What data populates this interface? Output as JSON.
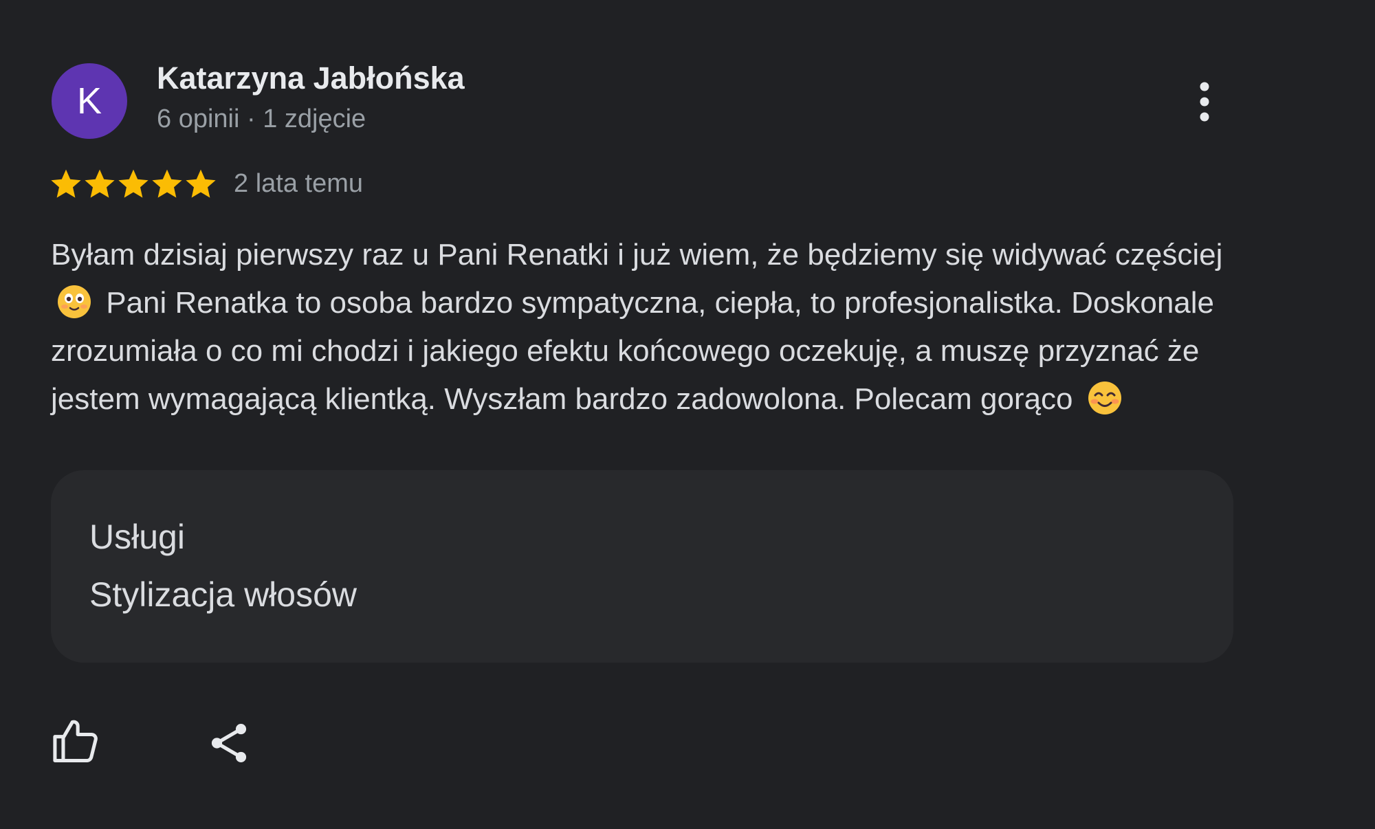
{
  "author": {
    "avatar_initial": "K",
    "avatar_color": "#5e35b1",
    "name": "Katarzyna Jabłońska",
    "meta": "6 opinii · 1 zdjęcie"
  },
  "menu": {
    "icon": "more-vert-icon"
  },
  "rating": {
    "stars": 5,
    "max": 5,
    "star_color": "#fbbc04",
    "time_ago": "2 lata temu"
  },
  "review": {
    "text_part1": "Byłam dzisiaj pierwszy raz u Pani Renatki i już wiem, że będziemy się widywać częściej",
    "emoji1": "smiling-face-emoji",
    "text_part2": "Pani Renatka to osoba bardzo sympatyczna, ciepła, to profesjonalistka. Doskonale zrozumiała o co mi chodzi i jakiego efektu końcowego oczekuję, a muszę przyznać że jestem wymagającą klientką. Wyszłam bardzo zadowolona. Polecam gorąco",
    "emoji2": "smiling-face-with-smiling-eyes-emoji"
  },
  "services": {
    "label": "Usługi",
    "value": "Stylizacja włosów"
  },
  "actions": {
    "like_icon": "thumbs-up-icon",
    "share_icon": "share-icon"
  },
  "colors": {
    "background": "#202124",
    "card": "#28292c",
    "text": "#dadce0",
    "secondary_text": "#9aa0a6"
  }
}
